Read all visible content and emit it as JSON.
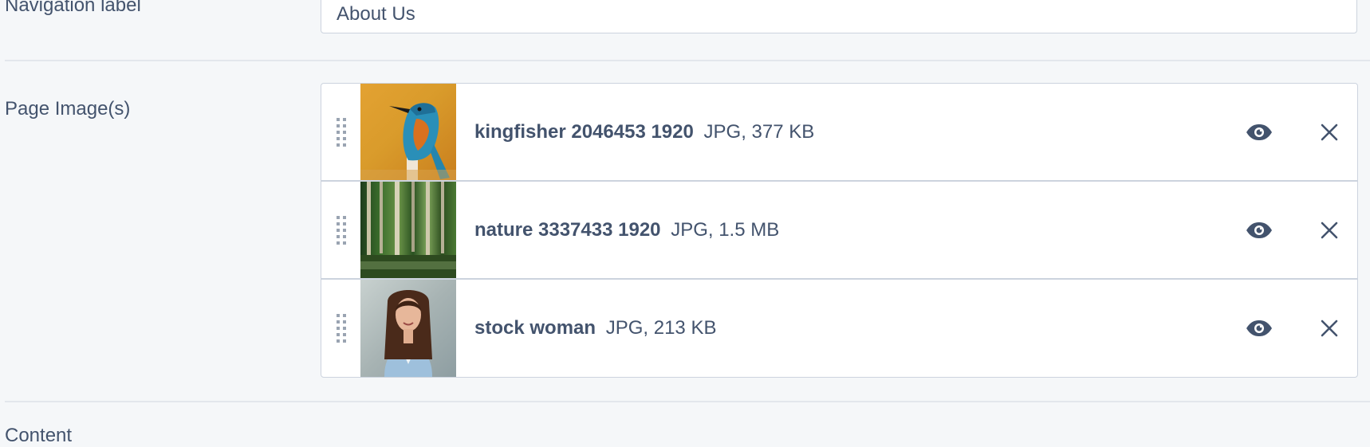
{
  "fields": {
    "navigation_label": {
      "label": "Navigation label",
      "value": "About Us"
    },
    "page_images": {
      "label": "Page Image(s)",
      "items": [
        {
          "name": "kingfisher 2046453 1920",
          "meta": "JPG, 377 KB",
          "thumbnail": "kingfisher-photo"
        },
        {
          "name": "nature 3337433 1920",
          "meta": "JPG, 1.5 MB",
          "thumbnail": "forest-photo"
        },
        {
          "name": "stock woman",
          "meta": "JPG, 213 KB",
          "thumbnail": "woman-portrait-photo"
        }
      ]
    },
    "content": {
      "label": "Content"
    }
  },
  "icons": {
    "drag": "drag-handle-icon",
    "view": "eye-icon",
    "remove": "close-icon"
  },
  "colors": {
    "text": "#43536d",
    "border": "#ccd3de",
    "background": "#f5f7f9"
  }
}
